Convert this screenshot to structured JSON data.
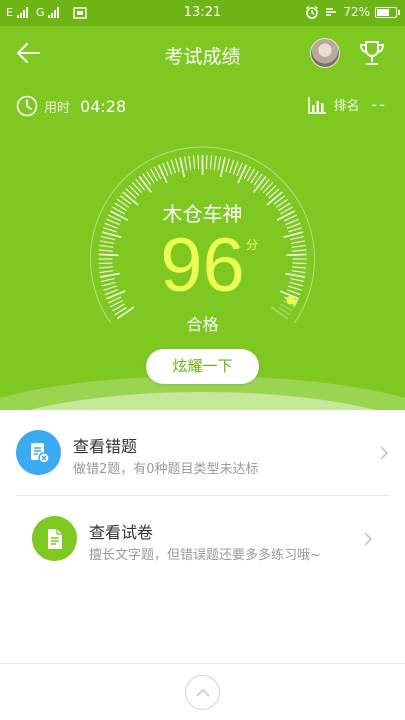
{
  "status_bar": {
    "signal1_label": "E",
    "signal2_label": "G",
    "time": "13:21",
    "battery_text": "72%",
    "battery_level": 0.72
  },
  "header": {
    "title": "考试成绩",
    "back_icon": "arrow-left-icon",
    "trophy_icon": "trophy-icon"
  },
  "stats": {
    "time_label": "用时",
    "time_value": "04:28",
    "rank_label": "排名",
    "rank_value": "--"
  },
  "result": {
    "name": "木仓车神",
    "score": "96",
    "unit": "分",
    "status": "合格",
    "score_fraction": 0.96,
    "share_label": "炫耀一下"
  },
  "list": [
    {
      "title": "查看错题",
      "subtitle": "做错2题，有0种题目类型未达标",
      "icon": "wrong-questions-icon",
      "color": "#3aabf0"
    },
    {
      "title": "查看试卷",
      "subtitle": "擅长文字题，但错误题还要多多练习哦~",
      "icon": "paper-document-icon",
      "color": "#7ec821"
    }
  ],
  "colors": {
    "brand_green": "#7ec821",
    "score_yellow": "#ebff54"
  }
}
